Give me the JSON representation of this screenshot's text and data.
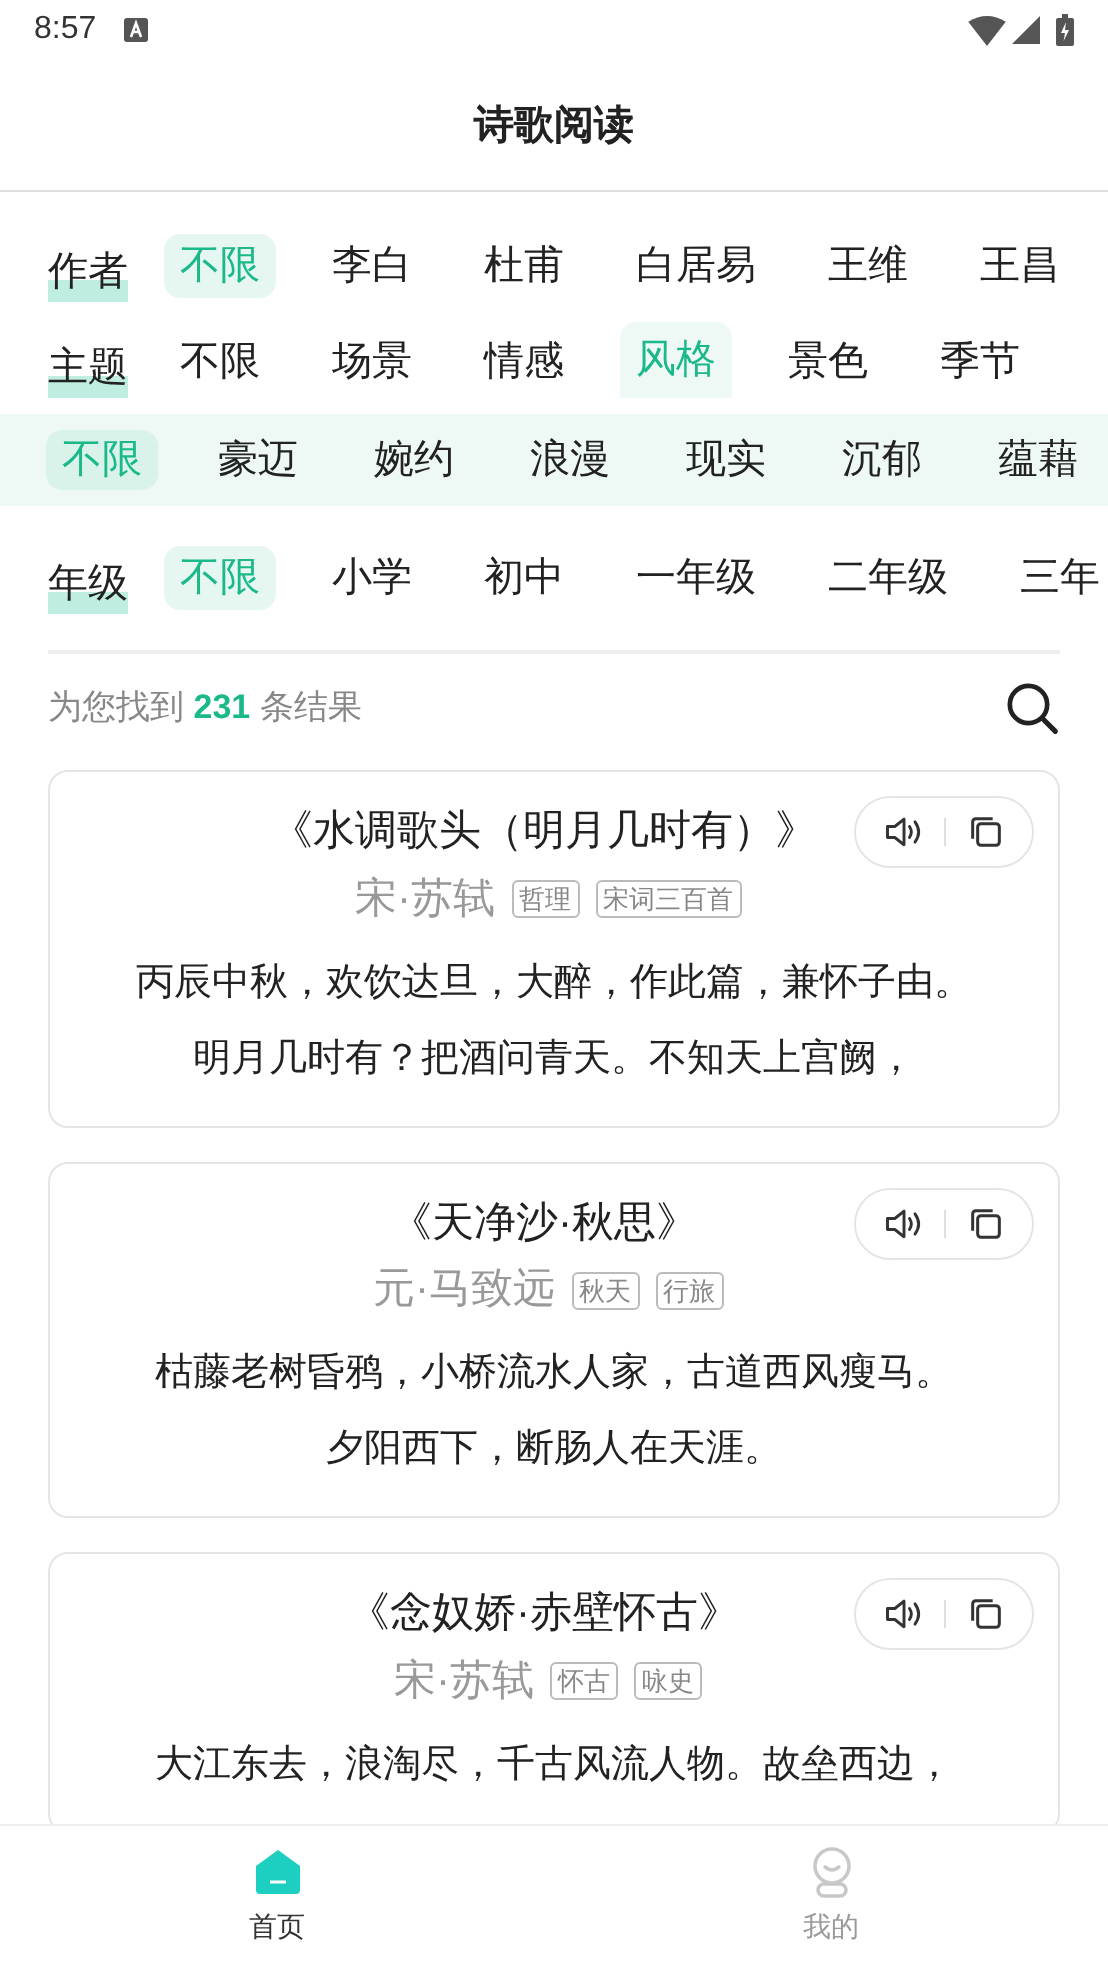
{
  "status_bar": {
    "time": "8:57"
  },
  "header": {
    "title": "诗歌阅读"
  },
  "filters": [
    {
      "label": "作者",
      "options": [
        {
          "label": "不限",
          "selected": true
        },
        {
          "label": "李白",
          "selected": false
        },
        {
          "label": "杜甫",
          "selected": false
        },
        {
          "label": "白居易",
          "selected": false
        },
        {
          "label": "王维",
          "selected": false
        },
        {
          "label": "王昌",
          "selected": false
        }
      ]
    },
    {
      "label": "主题",
      "options": [
        {
          "label": "不限",
          "selected": false
        },
        {
          "label": "场景",
          "selected": false
        },
        {
          "label": "情感",
          "selected": false
        },
        {
          "label": "风格",
          "selected": true
        },
        {
          "label": "景色",
          "selected": false
        },
        {
          "label": "季节",
          "selected": false
        }
      ],
      "sub_options": [
        {
          "label": "不限",
          "selected": true
        },
        {
          "label": "豪迈",
          "selected": false
        },
        {
          "label": "婉约",
          "selected": false
        },
        {
          "label": "浪漫",
          "selected": false
        },
        {
          "label": "现实",
          "selected": false
        },
        {
          "label": "沉郁",
          "selected": false
        },
        {
          "label": "蕴藉",
          "selected": false
        }
      ]
    },
    {
      "label": "年级",
      "options": [
        {
          "label": "不限",
          "selected": true
        },
        {
          "label": "小学",
          "selected": false
        },
        {
          "label": "初中",
          "selected": false
        },
        {
          "label": "一年级",
          "selected": false
        },
        {
          "label": "二年级",
          "selected": false
        },
        {
          "label": "三年",
          "selected": false
        }
      ]
    }
  ],
  "results": {
    "prefix": "为您找到",
    "count": "231",
    "suffix": "条结果"
  },
  "poems": [
    {
      "title": "《水调歌头（明月几时有）》",
      "author": "宋·苏轼",
      "tags": [
        "哲理",
        "宋词三百首"
      ],
      "lines": [
        "丙辰中秋，欢饮达旦，大醉，作此篇，兼怀子由。",
        "明月几时有？把酒问青天。不知天上宫阙，"
      ]
    },
    {
      "title": "《天净沙·秋思》",
      "author": "元·马致远",
      "tags": [
        "秋天",
        "行旅"
      ],
      "lines": [
        "枯藤老树昏鸦，小桥流水人家，古道西风瘦马。",
        "夕阳西下，断肠人在天涯。"
      ]
    },
    {
      "title": "《念奴娇·赤壁怀古》",
      "author": "宋·苏轼",
      "tags": [
        "怀古",
        "咏史"
      ],
      "lines": [
        "大江东去，浪淘尽，千古风流人物。故垒西边，"
      ]
    }
  ],
  "bottom_nav": [
    {
      "label": "首页",
      "kind": "home",
      "selected": true
    },
    {
      "label": "我的",
      "kind": "profile",
      "selected": false
    }
  ]
}
